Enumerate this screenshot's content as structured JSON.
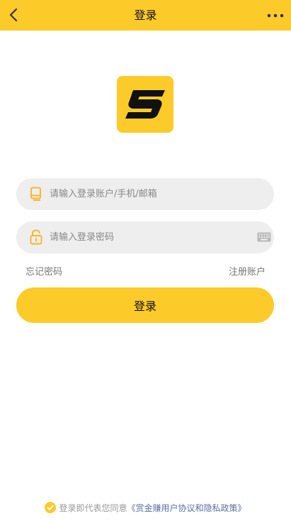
{
  "header": {
    "title": "登录",
    "back_icon": "chevron-left-icon",
    "more_icon": "more-dots-icon"
  },
  "logo": {
    "letter": "S"
  },
  "form": {
    "account_placeholder": "请输入登录账户/手机/邮箱",
    "password_placeholder": "请输入登录密码",
    "forgot_label": "忘记密码",
    "register_label": "注册账户",
    "login_label": "登录"
  },
  "agreement": {
    "prefix": "登录即代表您同意",
    "link": "《赏金赚用户协议和隐私政策》"
  },
  "colors": {
    "brand": "#FCCB2A",
    "field_bg": "#EEEEEE",
    "link": "#5a6fa6"
  }
}
